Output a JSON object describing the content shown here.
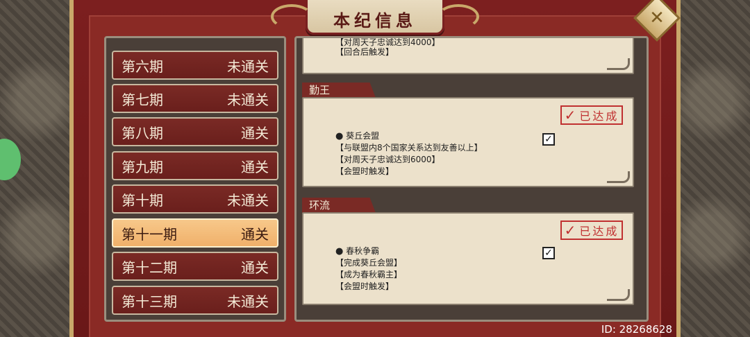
{
  "title": "本纪信息",
  "close_icon": "✕",
  "list": [
    {
      "period": "第六期",
      "status": "未通关",
      "selected": false
    },
    {
      "period": "第七期",
      "status": "未通关",
      "selected": false
    },
    {
      "period": "第八期",
      "status": "通关",
      "selected": false
    },
    {
      "period": "第九期",
      "status": "通关",
      "selected": false
    },
    {
      "period": "第十期",
      "status": "未通关",
      "selected": false
    },
    {
      "period": "第十一期",
      "status": "通关",
      "selected": true
    },
    {
      "period": "第十二期",
      "status": "通关",
      "selected": false
    },
    {
      "period": "第十三期",
      "status": "未通关",
      "selected": false
    }
  ],
  "top_card": {
    "lines": [
      "【对周天子忠诚达到4000】",
      "【回合后触发】"
    ]
  },
  "sections": [
    {
      "tab": "勤王",
      "stamp": "已达成",
      "stamp_check": "✓",
      "bullet": "●",
      "name": "葵丘会盟",
      "checkbox": "✓",
      "conditions": [
        "【与联盟内8个国家关系达到友善以上】",
        "【对周天子忠诚达到6000】",
        "【会盟时触发】"
      ]
    },
    {
      "tab": "环流",
      "stamp": "已达成",
      "stamp_check": "✓",
      "bullet": "●",
      "name": "春秋争霸",
      "checkbox": "✓",
      "conditions": [
        "【完成葵丘会盟】",
        "【成为春秋霸主】",
        "【会盟时触发】"
      ]
    }
  ],
  "id_label": "ID: 28268628"
}
